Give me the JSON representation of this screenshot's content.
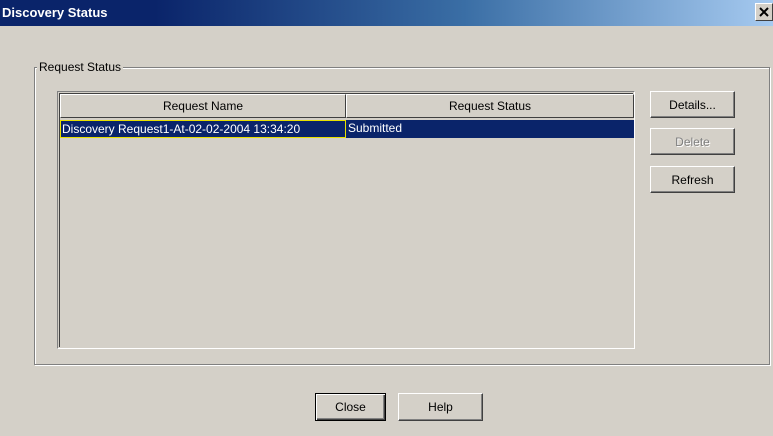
{
  "window": {
    "title": "Discovery Status"
  },
  "group": {
    "legend": "Request Status"
  },
  "table": {
    "headers": [
      "Request Name",
      "Request Status"
    ],
    "rows": [
      {
        "name": "Discovery Request1-At-02-02-2004 13:34:20",
        "status": "Submitted",
        "selected": true
      }
    ]
  },
  "side_buttons": {
    "details": "Details...",
    "delete": "Delete",
    "refresh": "Refresh"
  },
  "footer_buttons": {
    "close": "Close",
    "help": "Help"
  },
  "colors": {
    "selection": "#0a246a",
    "focus_border": "#e8e000",
    "window_bg": "#d4d0c8"
  },
  "icons": {
    "close": "close-icon"
  }
}
